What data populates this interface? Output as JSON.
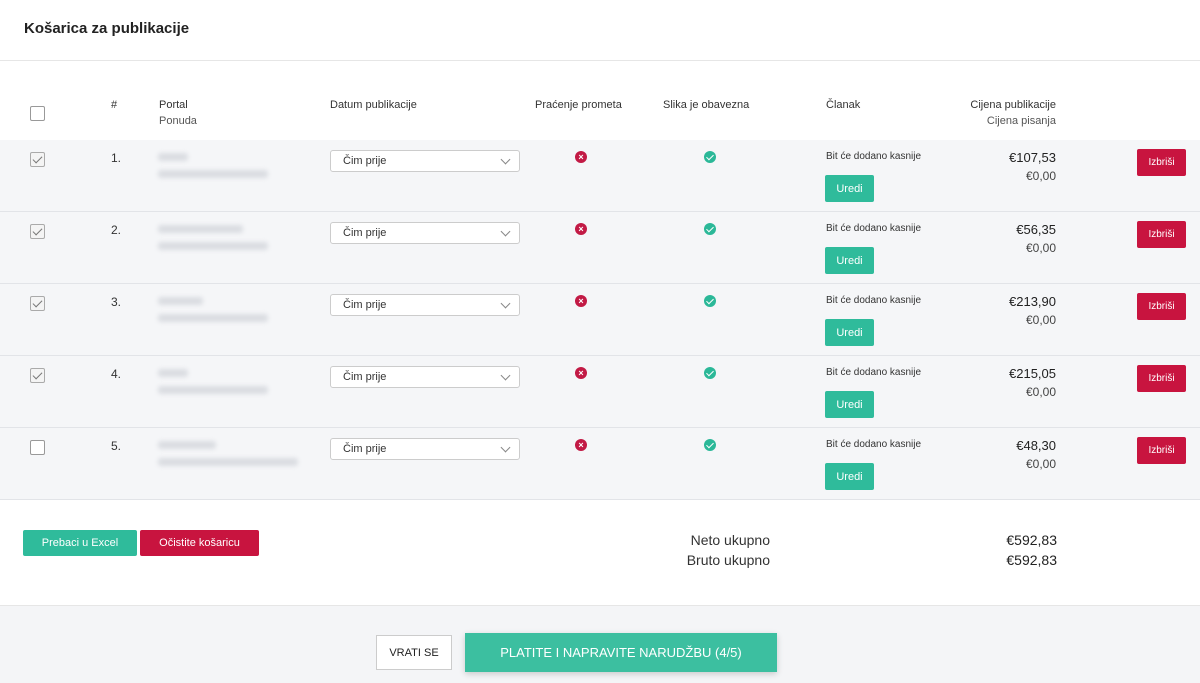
{
  "page_title": "Košarica za publikacije",
  "columns": {
    "num": "#",
    "portal": "Portal",
    "offer": "Ponuda",
    "date": "Datum publikacije",
    "tracking": "Praćenje prometa",
    "image_required": "Slika je obavezna",
    "article": "Članak",
    "publication_price": "Cijena publikacije",
    "writing_price": "Cijena pisanja"
  },
  "rows": [
    {
      "num": "1.",
      "checked": true,
      "date": "Čim prije",
      "article": "Bit će dodano kasnije",
      "edit": "Uredi",
      "price": "€107,53",
      "writing": "€0,00",
      "delete": "Izbriši"
    },
    {
      "num": "2.",
      "checked": true,
      "date": "Čim prije",
      "article": "Bit će dodano kasnije",
      "edit": "Uredi",
      "price": "€56,35",
      "writing": "€0,00",
      "delete": "Izbriši"
    },
    {
      "num": "3.",
      "checked": true,
      "date": "Čim prije",
      "article": "Bit će dodano kasnije",
      "edit": "Uredi",
      "price": "€213,90",
      "writing": "€0,00",
      "delete": "Izbriši"
    },
    {
      "num": "4.",
      "checked": true,
      "date": "Čim prije",
      "article": "Bit će dodano kasnije",
      "edit": "Uredi",
      "price": "€215,05",
      "writing": "€0,00",
      "delete": "Izbriši"
    },
    {
      "num": "5.",
      "checked": false,
      "date": "Čim prije",
      "article": "Bit će dodano kasnije",
      "edit": "Uredi",
      "price": "€48,30",
      "writing": "€0,00",
      "delete": "Izbriši"
    }
  ],
  "actions": {
    "excel": "Prebaci u Excel",
    "clear": "Očistite košaricu"
  },
  "totals": {
    "net_label": "Neto ukupno",
    "net_value": "€592,83",
    "gross_label": "Bruto ukupno",
    "gross_value": "€592,83"
  },
  "footer": {
    "back": "VRATI SE",
    "pay": "PLATITE I NAPRAVITE NARUDŽBU (4/5)"
  },
  "colors": {
    "accent_green": "#2fbb9b",
    "accent_red": "#c8143f"
  }
}
